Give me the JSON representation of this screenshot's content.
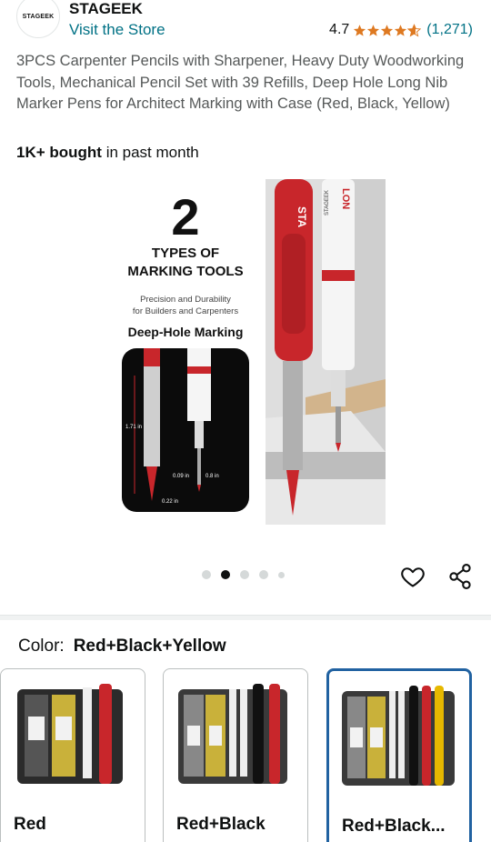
{
  "brand": {
    "logo_text": "STAGEEK",
    "name": "STAGEEK",
    "visit_store": "Visit the Store"
  },
  "rating": {
    "value": "4.7",
    "stars": 4.7,
    "count": "(1,271)"
  },
  "product": {
    "title": "3PCS Carpenter Pencils with Sharpener, Heavy Duty Woodworking Tools, Mechanical Pencil Set with 39 Refills, Deep Hole Long Nib Marker Pens for Architect Marking with Case (Red, Black, Yellow)",
    "bought_bold": "1K+ bought",
    "bought_rest": " in past month"
  },
  "hero": {
    "big_number": "2",
    "types_line1": "TYPES OF",
    "types_line2": "MARKING TOOLS",
    "sub_line1": "Precision and Durability",
    "sub_line2": "for Builders and Carpenters",
    "deep_hole": "Deep-Hole Marking",
    "meas_length": "1.71 in",
    "meas_a": "0.09 in",
    "meas_b": "0.8 in",
    "meas_c": "0.22 in",
    "pencil_text": "STA",
    "marker_text": "LON",
    "marker_brand": "STAGEEK"
  },
  "carousel": {
    "dot_count": 5,
    "active_index": 1
  },
  "icons": {
    "heart": "heart-icon",
    "share": "share-icon"
  },
  "color": {
    "label": "Color:",
    "selected": "Red+Black+Yellow"
  },
  "swatches": [
    {
      "label": "Red",
      "selected": false
    },
    {
      "label": "Red+Black",
      "selected": false
    },
    {
      "label": "Red+Black...",
      "selected": true
    }
  ],
  "colors": {
    "link": "#007185",
    "star": "#de7921",
    "selected_border": "#2162a1",
    "pencil_red": "#c8262b"
  }
}
